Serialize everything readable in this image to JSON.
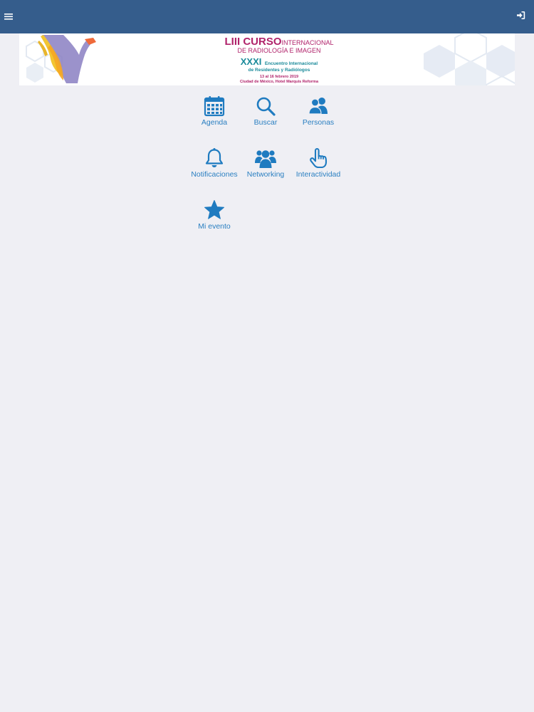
{
  "colors": {
    "topbar": "#355d8c",
    "accent": "#1f7bc0",
    "background": "#efeff4"
  },
  "topbar": {
    "menu_icon": "hamburger-menu-icon",
    "login_icon": "sign-in-icon"
  },
  "banner": {
    "line1_bold": "LIII CURSO",
    "line1_rest": "INTERNACIONAL",
    "line2": "DE RADIOLOGÍA E IMAGEN",
    "line3_bold": "XXXI",
    "line3_rest": "Encuentro Internacional",
    "line4": "de Residentes y Radiólogos",
    "line5": "13 al 16 febrero 2019",
    "line6": "Ciudad de México, Hotel Marquis Reforma"
  },
  "menu": {
    "items": [
      {
        "label": "Agenda",
        "icon": "calendar-icon"
      },
      {
        "label": "Buscar",
        "icon": "search-icon"
      },
      {
        "label": "Personas",
        "icon": "users-icon"
      },
      {
        "label": "Notificaciones",
        "icon": "bell-icon"
      },
      {
        "label": "Networking",
        "icon": "group-icon"
      },
      {
        "label": "Interactividad",
        "icon": "pointer-hand-icon"
      },
      {
        "label": "Mi evento",
        "icon": "star-icon"
      }
    ]
  }
}
